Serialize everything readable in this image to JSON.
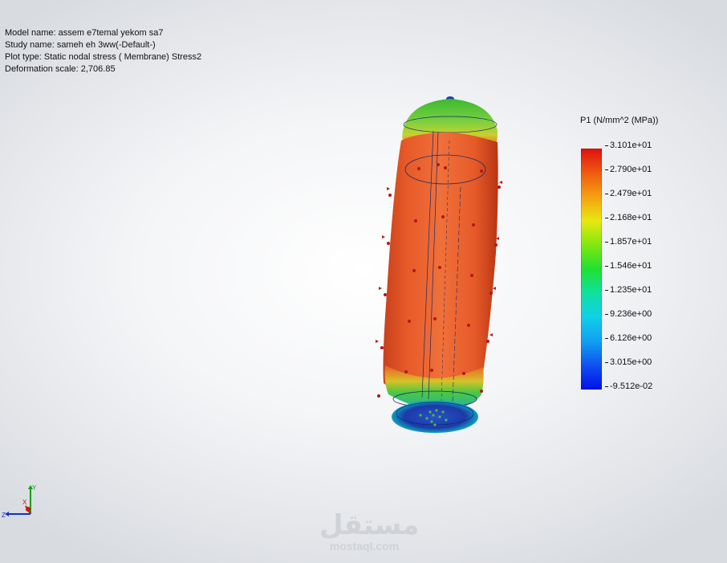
{
  "info": {
    "model_name": "Model name: assem e7temal yekom sa7",
    "study_name": "Study name: sameh eh 3ww(-Default-)",
    "plot_type": "Plot type: Static nodal stress ( Membrane) Stress2",
    "deformation_scale": "Deformation scale: 2,706.85"
  },
  "legend": {
    "title": "P1 (N/mm^2 (MPa))",
    "values": [
      "3.101e+01",
      "2.790e+01",
      "2.479e+01",
      "2.168e+01",
      "1.857e+01",
      "1.546e+01",
      "1.235e+01",
      "9.236e+00",
      "6.126e+00",
      "3.015e+00",
      "-9.512e-02"
    ],
    "colors": [
      "#e01010",
      "#ee5a10",
      "#f5a010",
      "#e8e810",
      "#80e810",
      "#20e030",
      "#10e0a0",
      "#10d0e8",
      "#10a0f0",
      "#1050f0",
      "#0010e8"
    ]
  },
  "triad": {
    "x": "X",
    "y": "Y",
    "z": "Z",
    "colors": {
      "x": "#d01010",
      "y": "#10a010",
      "z": "#1030d0"
    }
  },
  "model": {
    "icon": "pressure-vessel-stress-plot",
    "body_color": "#e65a28",
    "cap_color": "#5cc83c",
    "base_color": "#1a3fb0",
    "arrow_color": "#b01818"
  },
  "watermark": {
    "logo": "مستقل",
    "url": "mostaql.com"
  }
}
